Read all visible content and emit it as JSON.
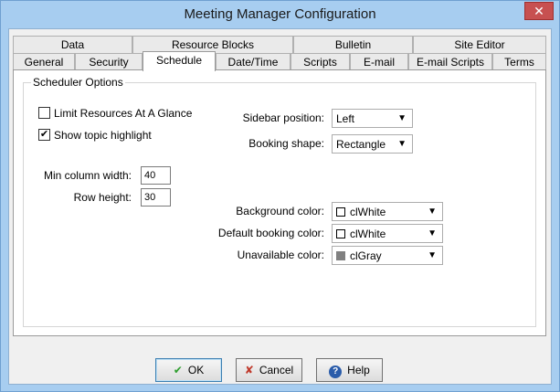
{
  "window": {
    "title": "Meeting Manager Configuration",
    "close_symbol": "✕"
  },
  "tabs": {
    "row1": [
      "Data",
      "Resource Blocks",
      "Bulletin",
      "Site Editor"
    ],
    "row2": [
      "General",
      "Security",
      "Schedule",
      "Date/Time",
      "Scripts",
      "E-mail",
      "E-mail Scripts",
      "Terms"
    ],
    "active": "Schedule"
  },
  "scheduler": {
    "group_label": "Scheduler Options",
    "limit_resources": {
      "label": "Limit Resources At A Glance",
      "checked": false
    },
    "show_topic": {
      "label": "Show topic highlight",
      "checked": true,
      "mark": "✔"
    },
    "min_column_width": {
      "label": "Min column width:",
      "value": "40"
    },
    "row_height": {
      "label": "Row height:",
      "value": "30"
    },
    "sidebar_position": {
      "label": "Sidebar position:",
      "value": "Left"
    },
    "booking_shape": {
      "label": "Booking shape:",
      "value": "Rectangle"
    },
    "background_color": {
      "label": "Background color:",
      "value": "clWhite",
      "swatch": "#ffffff"
    },
    "default_booking_color": {
      "label": "Default booking color:",
      "value": "clWhite",
      "swatch": "#ffffff"
    },
    "unavailable_color": {
      "label": "Unavailable color:",
      "value": "clGray",
      "swatch": "#808080"
    }
  },
  "buttons": {
    "ok": {
      "label": "OK",
      "icon": "✔"
    },
    "cancel": {
      "label": "Cancel",
      "icon": "✘"
    },
    "help": {
      "label": "Help",
      "icon": "?"
    }
  },
  "colors": {
    "ok_icon": "#2e9e2e",
    "cancel_icon": "#c0392b",
    "help_icon": "#2a5caa"
  }
}
